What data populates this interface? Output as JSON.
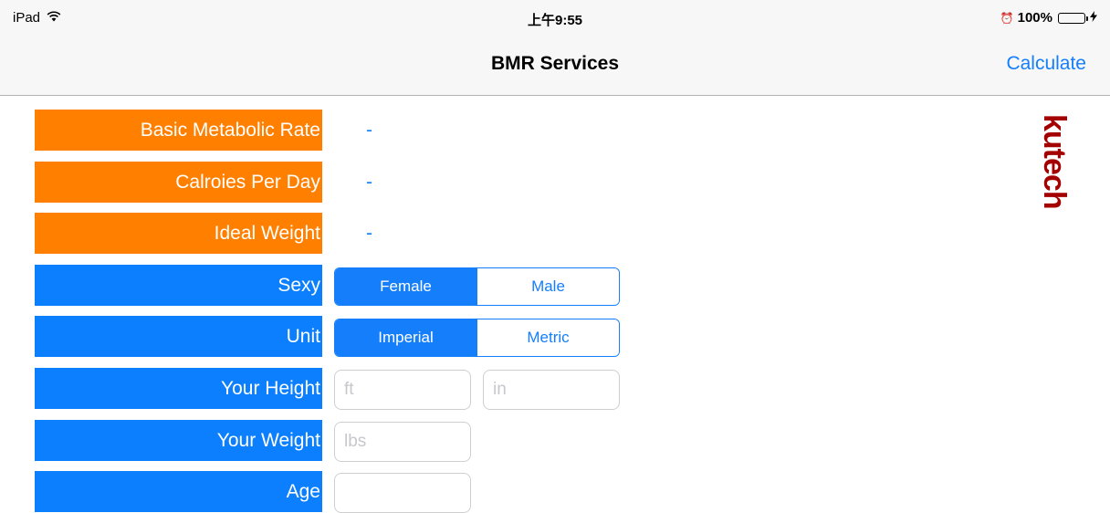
{
  "statusbar": {
    "device": "iPad",
    "time": "上午9:55",
    "alarm": "⏰",
    "battery_pct": "100%",
    "battery_level": 1.0
  },
  "navbar": {
    "title": "BMR Services",
    "action_label": "Calculate"
  },
  "results": [
    {
      "label": "Basic Metabolic Rate",
      "value": "-"
    },
    {
      "label": "Calroies Per Day",
      "value": "-"
    },
    {
      "label": "Ideal Weight",
      "value": "-"
    }
  ],
  "inputs": {
    "sex": {
      "label": "Sexy",
      "options": [
        "Female",
        "Male"
      ],
      "selected": "Female"
    },
    "unit": {
      "label": "Unit",
      "options": [
        "Imperial",
        "Metric"
      ],
      "selected": "Imperial"
    },
    "height": {
      "label": "Your Height",
      "ft_placeholder": "ft",
      "in_placeholder": "in",
      "ft_value": "",
      "in_value": ""
    },
    "weight": {
      "label": "Your Weight",
      "placeholder": "lbs",
      "value": ""
    },
    "age": {
      "label": "Age",
      "placeholder": "",
      "value": ""
    }
  },
  "brand": {
    "text": "kutech",
    "color": "#a50000"
  },
  "colors": {
    "accent": "#157efb",
    "result_label_bg": "#ff8000",
    "input_label_bg": "#0b7ffe"
  }
}
